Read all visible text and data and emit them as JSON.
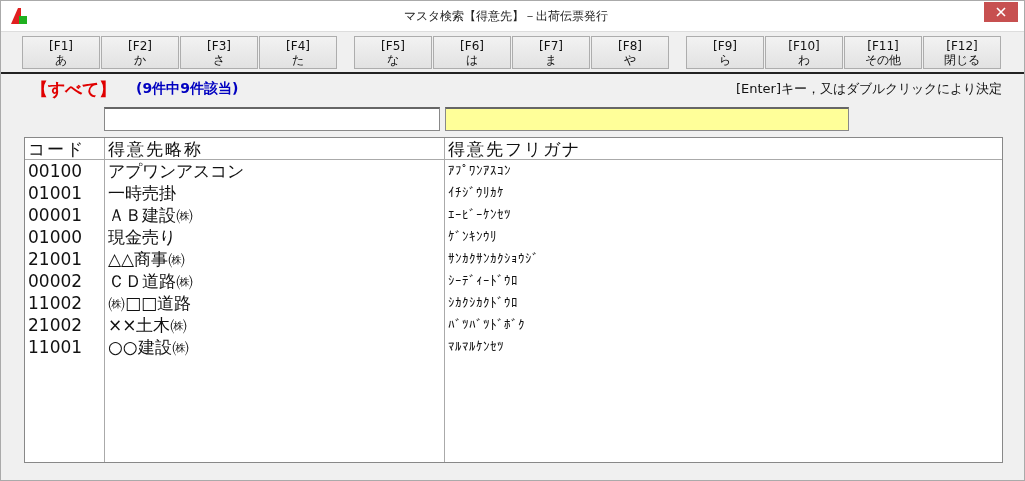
{
  "window": {
    "title": "マスタ検索【得意先】－出荷伝票発行"
  },
  "function_keys": [
    [
      {
        "key": "[F1]",
        "label": "あ"
      },
      {
        "key": "[F2]",
        "label": "か"
      },
      {
        "key": "[F3]",
        "label": "さ"
      },
      {
        "key": "[F4]",
        "label": "た"
      }
    ],
    [
      {
        "key": "[F5]",
        "label": "な"
      },
      {
        "key": "[F6]",
        "label": "は"
      },
      {
        "key": "[F7]",
        "label": "ま"
      },
      {
        "key": "[F8]",
        "label": "や"
      }
    ],
    [
      {
        "key": "[F9]",
        "label": "ら"
      },
      {
        "key": "[F10]",
        "label": "わ"
      },
      {
        "key": "[F11]",
        "label": "その他"
      },
      {
        "key": "[F12]",
        "label": "閉じる"
      }
    ]
  ],
  "filter": {
    "category": "【すべて】",
    "count": "(9件中9件該当)",
    "hint": "[Enter]キー，又はダブルクリックにより決定"
  },
  "table": {
    "columns": [
      "コード",
      "得意先略称",
      "得意先フリガナ"
    ],
    "rows": [
      [
        "00100",
        "アプワンアスコン",
        "ｱﾌﾟﾜﾝｱｽｺﾝ"
      ],
      [
        "01001",
        "一時売掛",
        "ｲﾁｼﾞｳﾘｶｹ"
      ],
      [
        "00001",
        "ＡＢ建設㈱",
        "ｴｰﾋﾞｰｹﾝｾﾂ"
      ],
      [
        "01000",
        "現金売り",
        "ｹﾞﾝｷﾝｳﾘ"
      ],
      [
        "21001",
        "△△商事㈱",
        "ｻﾝｶｸｻﾝｶｸｼｮｳｼﾞ"
      ],
      [
        "00002",
        "ＣＤ道路㈱",
        "ｼｰﾃﾞｨｰﾄﾞｳﾛ"
      ],
      [
        "11002",
        "㈱□□道路",
        "ｼｶｸｼｶｸﾄﾞｳﾛ"
      ],
      [
        "21002",
        "××土木㈱",
        "ﾊﾞﾂﾊﾞﾂﾄﾞﾎﾞｸ"
      ],
      [
        "11001",
        "○○建設㈱",
        "ﾏﾙﾏﾙｹﾝｾﾂ"
      ]
    ]
  }
}
